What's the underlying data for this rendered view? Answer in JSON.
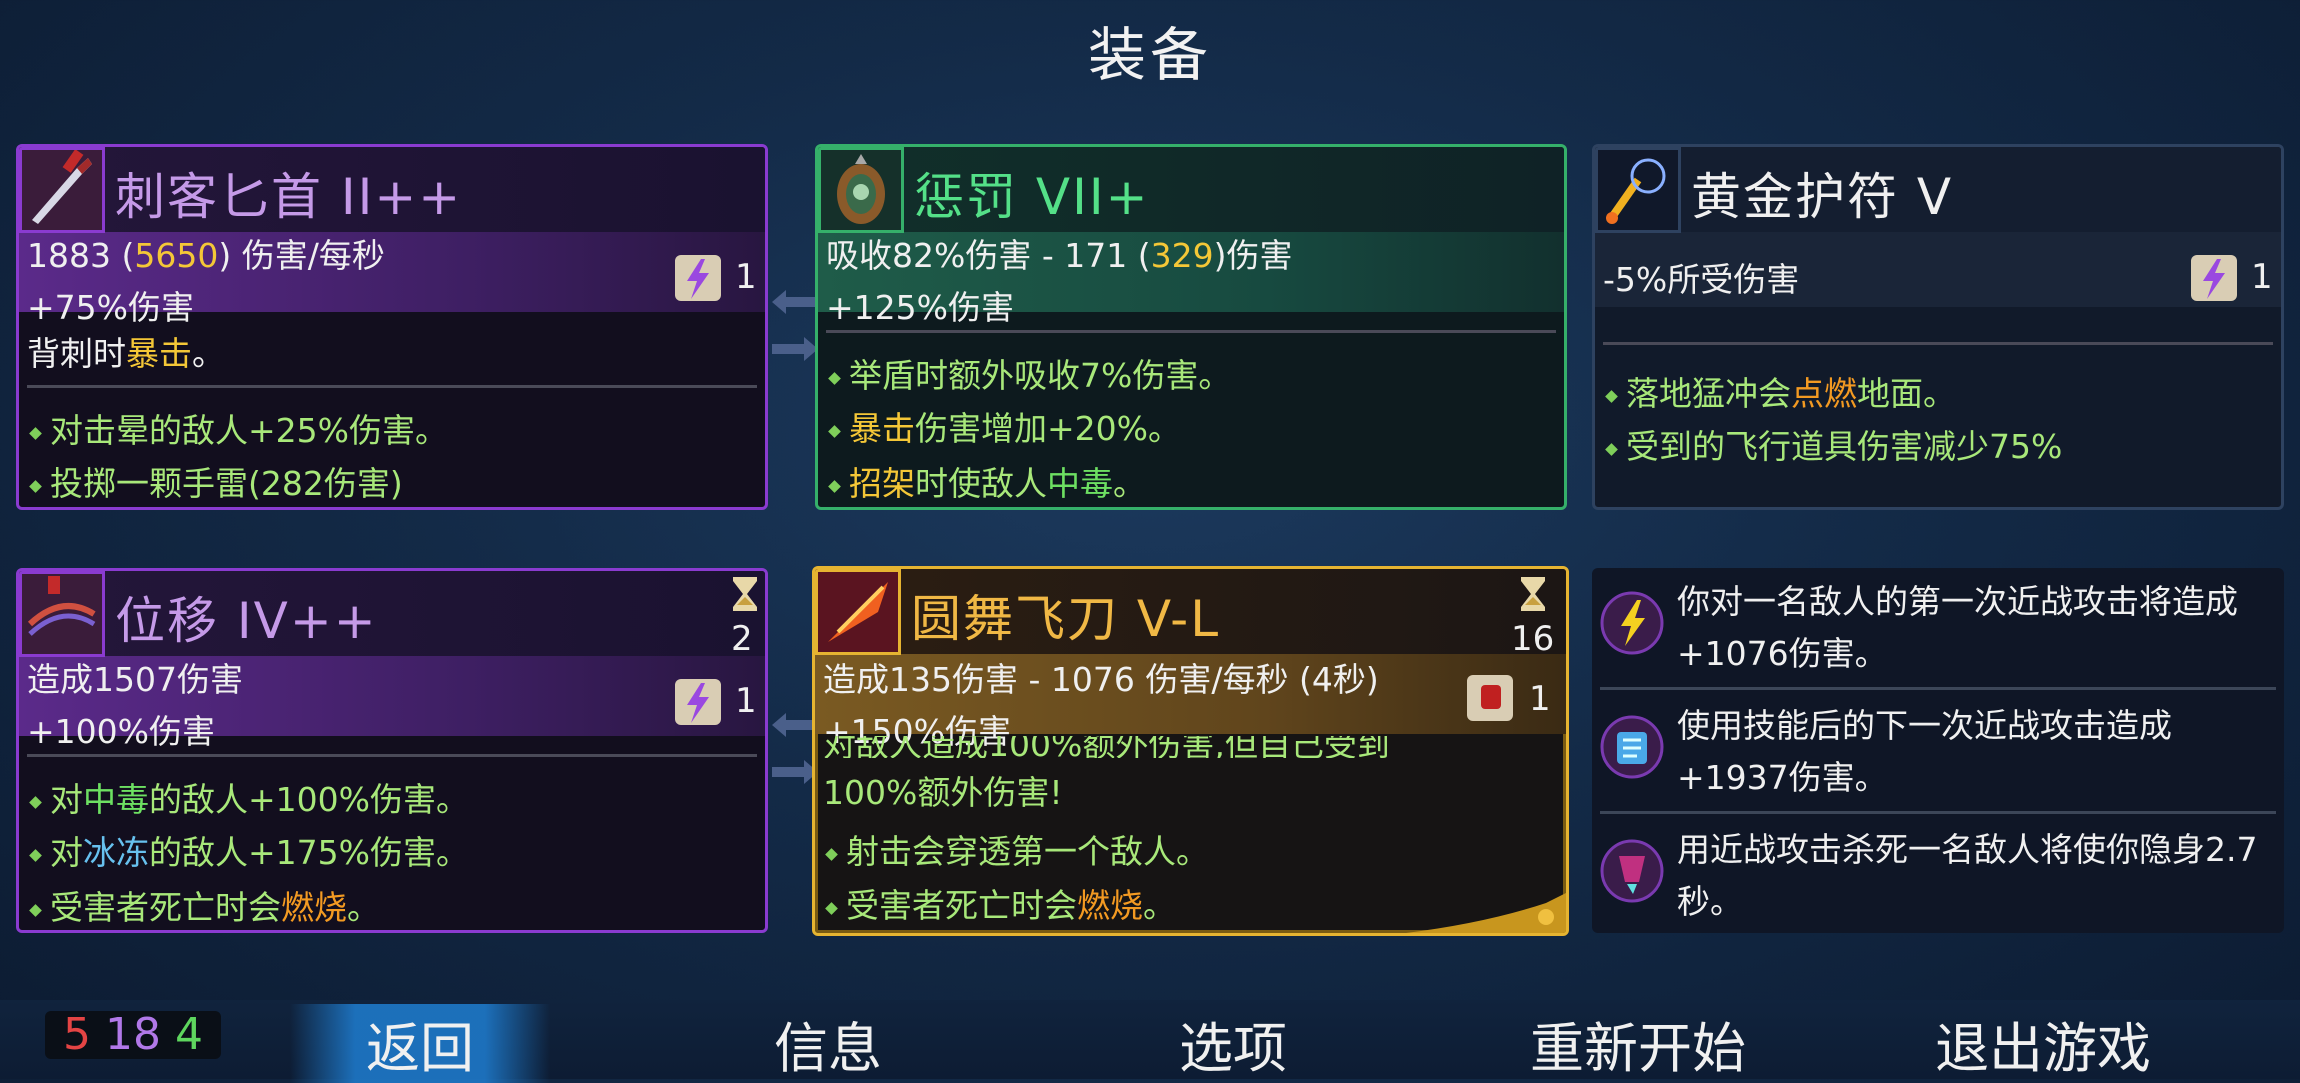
{
  "page_title": "装备",
  "cards": [
    {
      "name": "刺客匕首 II++",
      "stat_prefix": "1883 (",
      "stat_highlight": "5650",
      "stat_suffix": ") 伤害/每秒",
      "line2": "+75%伤害",
      "line3_prefix": "背刺时",
      "line3_highlight": "暴击",
      "line3_suffix": "。",
      "scroll_count": "1",
      "bullets": [
        "对击晕的敌人+25%伤害。",
        "投掷一颗手雷(282伤害)"
      ]
    },
    {
      "name": "惩罚 VII+",
      "stat_prefix": "吸收82%伤害 - 171 (",
      "stat_highlight": "329",
      "stat_suffix": ")伤害",
      "line2": "+125%伤害",
      "bullet1": "举盾时额外吸收7%伤害。",
      "bullet2_hl": "暴击",
      "bullet2_rest": "伤害增加+20%。",
      "bullet3_hl": "招架",
      "bullet3_mid": "时使敌人",
      "bullet3_poison": "中毒",
      "bullet3_end": "。"
    },
    {
      "name": "黄金护符 V",
      "stat": "-5%所受伤害",
      "scroll_count": "1",
      "bullet1_prefix": "落地猛冲会",
      "bullet1_fire": "点燃",
      "bullet1_suffix": "地面。",
      "bullet2": "受到的飞行道具伤害减少75%"
    },
    {
      "name": "位移 IV++",
      "cooldown": "2",
      "stat": "造成1507伤害",
      "line2": "+100%伤害",
      "scroll_count": "1",
      "bullet1_prefix": "对",
      "bullet1_poison": "中毒",
      "bullet1_suffix": "的敌人+100%伤害。",
      "bullet2_prefix": "对",
      "bullet2_ice": "冰冻",
      "bullet2_suffix": "的敌人+175%伤害。",
      "bullet3_prefix": "受害者死亡时会",
      "bullet3_fire": "燃烧",
      "bullet3_suffix": "。"
    },
    {
      "name": "圆舞飞刀 V-L",
      "cooldown": "16",
      "stat": "造成135伤害 - 1076 伤害/每秒 (4秒)",
      "line2": "+150%伤害",
      "scroll_count": "1",
      "partial_line": "对敌人造成100%额外伤害,但自己受到",
      "line4": "100%额外伤害!",
      "bullet1": "射击会穿透第一个敌人。",
      "bullet2_prefix": "受害者死亡时会",
      "bullet2_fire": "燃烧",
      "bullet2_suffix": "。"
    }
  ],
  "mutations": [
    {
      "icon": "lightning-mutation-icon",
      "text": "你对一名敌人的第一次近战攻击将造成+1076伤害。"
    },
    {
      "icon": "scroll-mutation-icon",
      "text": "使用技能后的下一次近战攻击造成+1937伤害。"
    },
    {
      "icon": "stealth-mutation-icon",
      "text": "用近战攻击杀死一名敌人将使你隐身2.7秒。"
    }
  ],
  "scores": {
    "brutality": "5",
    "tactics": "18",
    "survival": "4"
  },
  "menu": [
    "返回",
    "信息",
    "选项",
    "重新开始",
    "退出游戏"
  ],
  "colors": {
    "purple": "#8a3bd0",
    "green": "#35b06a",
    "gold": "#e6b431",
    "highlight": "#f4c737",
    "fire": "#f39a22",
    "poison": "#6de062",
    "ice": "#67c1ef"
  }
}
